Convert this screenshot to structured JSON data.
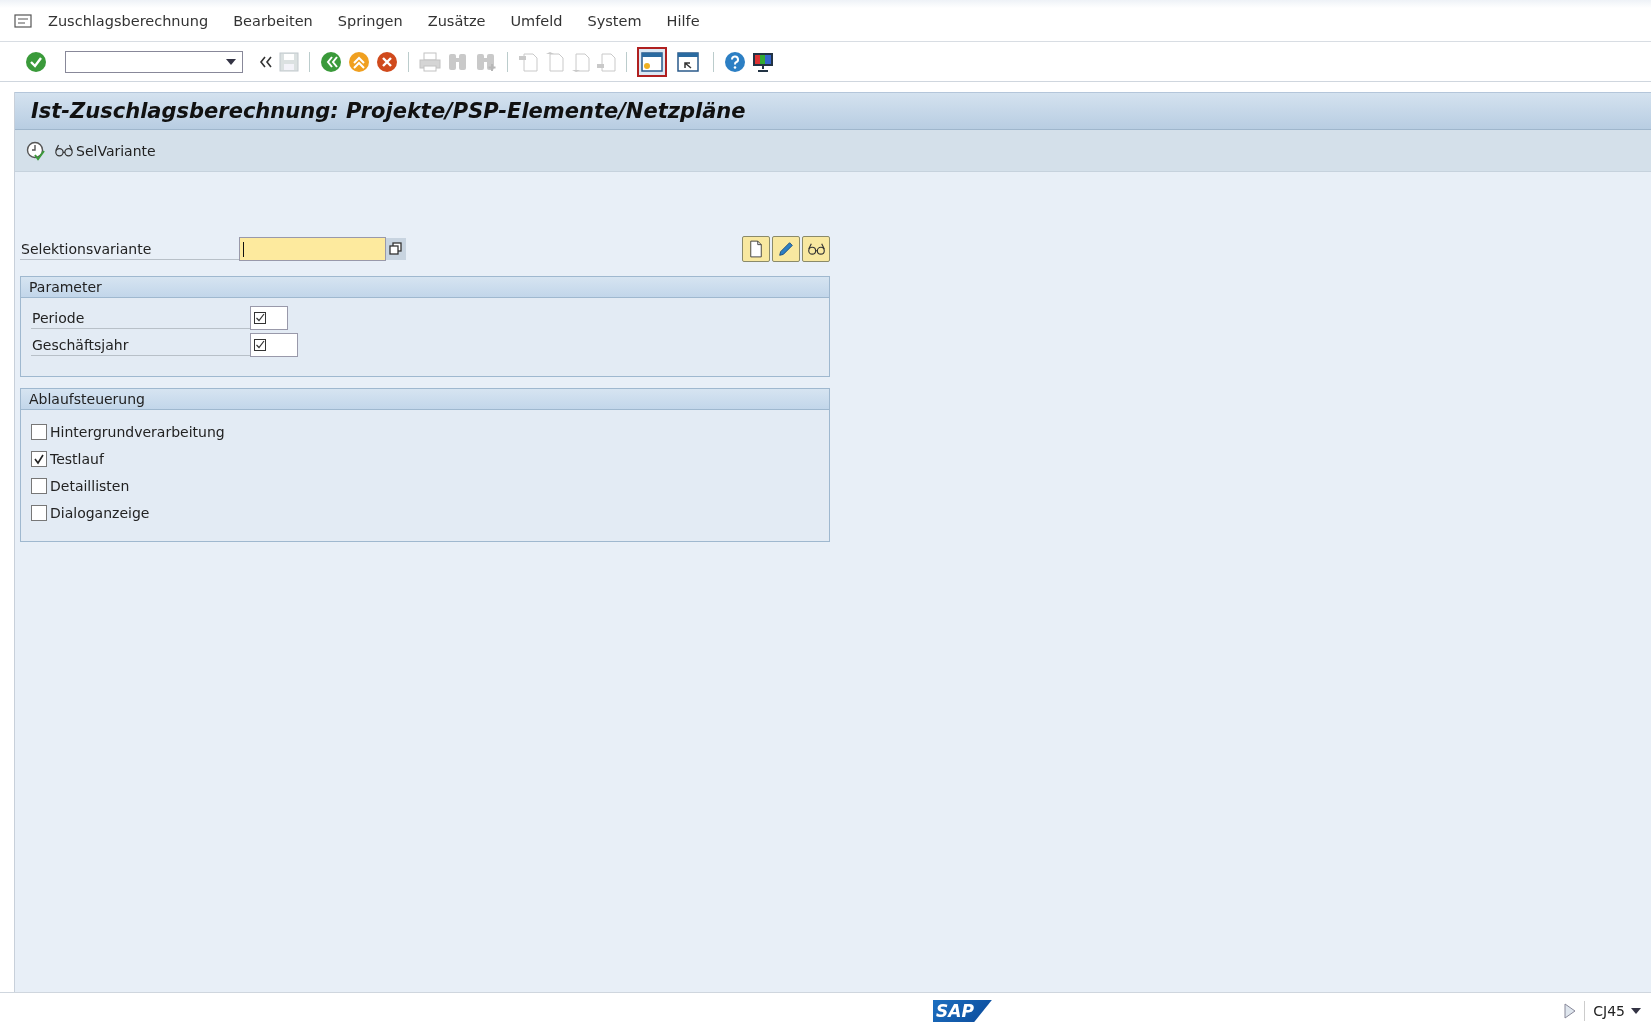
{
  "menu": [
    {
      "label": "Zuschlagsberechnung"
    },
    {
      "label": "Bearbeiten"
    },
    {
      "label": "Springen"
    },
    {
      "label": "Zusätze"
    },
    {
      "label": "Umfeld"
    },
    {
      "label": "System"
    },
    {
      "label": "Hilfe"
    }
  ],
  "toolbar": [
    {
      "kind": "enter",
      "disabled": false
    },
    {
      "kind": "command"
    },
    {
      "kind": "collapse",
      "disabled": false
    },
    {
      "kind": "save",
      "disabled": true
    },
    {
      "kind": "sep"
    },
    {
      "kind": "back",
      "disabled": false
    },
    {
      "kind": "exit",
      "disabled": false
    },
    {
      "kind": "cancel",
      "disabled": false
    },
    {
      "kind": "sep"
    },
    {
      "kind": "print",
      "disabled": true
    },
    {
      "kind": "find",
      "disabled": true
    },
    {
      "kind": "find-next",
      "disabled": true
    },
    {
      "kind": "sep"
    },
    {
      "kind": "first",
      "disabled": true
    },
    {
      "kind": "prev",
      "disabled": true
    },
    {
      "kind": "next",
      "disabled": true
    },
    {
      "kind": "last",
      "disabled": true
    },
    {
      "kind": "sep"
    },
    {
      "kind": "new-session",
      "disabled": false,
      "selected": true
    },
    {
      "kind": "shortcut",
      "disabled": false,
      "selected": false
    },
    {
      "kind": "sep"
    },
    {
      "kind": "help",
      "disabled": false
    },
    {
      "kind": "layout",
      "disabled": false
    }
  ],
  "window": {
    "title": "Ist-Zuschlagsberechnung: Projekte/PSP-Elemente/Netzpläne"
  },
  "app_toolbar": {
    "button": "SelVariante"
  },
  "selection_variant": {
    "label": "Selektionsvariante",
    "focused": true
  },
  "parameters": {
    "title": "Parameter",
    "fields": [
      {
        "label": "Periode",
        "required": true
      },
      {
        "label": "Geschäftsjahr",
        "required": true
      }
    ]
  },
  "control": {
    "title": "Ablaufsteuerung",
    "options": [
      {
        "label": "Hintergrundverarbeitung",
        "checked": false
      },
      {
        "label": "Testlauf",
        "checked": true
      },
      {
        "label": "Detaillisten",
        "checked": false
      },
      {
        "label": "Dialoganzeige",
        "checked": false
      }
    ]
  },
  "status_bar": {
    "logo": "SAP",
    "transaction": "CJ45"
  }
}
